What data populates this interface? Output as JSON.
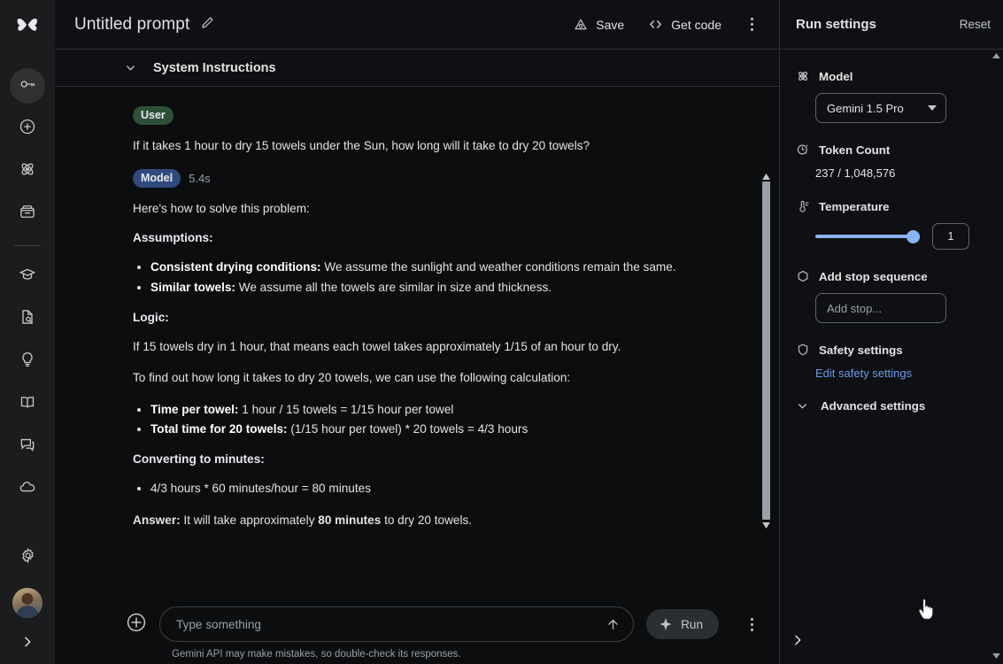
{
  "app": {
    "logo_icon": "butterfly-logo-icon"
  },
  "sidebar": {
    "items": [
      {
        "icon": "key-icon",
        "name": "api-key",
        "active": true
      },
      {
        "icon": "plus-circle-icon",
        "name": "new-prompt",
        "active": false
      },
      {
        "icon": "atom-icon",
        "name": "tune-model",
        "active": false
      },
      {
        "icon": "archive-icon",
        "name": "library",
        "active": false
      },
      {
        "icon": "graduation-cap-icon",
        "name": "learn",
        "active": false
      },
      {
        "icon": "document-search-icon",
        "name": "documentation",
        "active": false
      },
      {
        "icon": "lightbulb-icon",
        "name": "examples",
        "active": false
      },
      {
        "icon": "book-icon",
        "name": "guide",
        "active": false
      },
      {
        "icon": "chat-icon",
        "name": "feedback",
        "active": false
      },
      {
        "icon": "cloud-icon",
        "name": "cloud-console",
        "active": false
      }
    ],
    "settings_icon": "gear-icon",
    "avatar_name": "user-avatar",
    "expand_icon": "chevron-right-icon"
  },
  "topbar": {
    "title": "Untitled prompt",
    "edit_icon": "pencil-icon",
    "save_label": "Save",
    "save_icon": "save-cloud-icon",
    "get_code_label": "Get code",
    "get_code_icon": "code-brackets-icon",
    "more_icon": "kebab-menu-icon"
  },
  "system_instructions": {
    "label": "System Instructions",
    "chevron_icon": "chevron-down-icon",
    "expanded": false
  },
  "conversation": {
    "turns": [
      {
        "role_badge": "User",
        "role": "user",
        "latency": "",
        "blocks": [
          {
            "type": "p",
            "text": "If it takes 1 hour to dry 15 towels under the Sun, how long will it take to dry 20 towels?"
          }
        ]
      },
      {
        "role_badge": "Model",
        "role": "model",
        "latency": "5.4s",
        "blocks": [
          {
            "type": "p",
            "text": "Here's how to solve this problem:"
          },
          {
            "type": "h",
            "text": "Assumptions:"
          },
          {
            "type": "ul",
            "items": [
              {
                "bold": "Consistent drying conditions:",
                "rest": " We assume the sunlight and weather conditions remain the same."
              },
              {
                "bold": "Similar towels:",
                "rest": " We assume all the towels are similar in size and thickness."
              }
            ]
          },
          {
            "type": "h",
            "text": "Logic:"
          },
          {
            "type": "p",
            "text": "If 15 towels dry in 1 hour, that means each towel takes approximately 1/15 of an hour to dry."
          },
          {
            "type": "p",
            "text": "To find out how long it takes to dry 20 towels, we can use the following calculation:"
          },
          {
            "type": "ul",
            "items": [
              {
                "bold": "Time per towel:",
                "rest": " 1 hour / 15 towels = 1/15 hour per towel"
              },
              {
                "bold": "Total time for 20 towels:",
                "rest": " (1/15 hour per towel) * 20 towels = 4/3 hours"
              }
            ]
          },
          {
            "type": "h",
            "text": "Converting to minutes:"
          },
          {
            "type": "ul",
            "items": [
              {
                "bold": "",
                "rest": "4/3 hours * 60 minutes/hour = 80 minutes"
              }
            ]
          },
          {
            "type": "answer",
            "label": "Answer:",
            "mid": " It will take approximately ",
            "bold": "80 minutes",
            "tail": " to dry 20 towels."
          }
        ]
      }
    ]
  },
  "composer": {
    "add_icon": "plus-circle-icon",
    "placeholder": "Type something",
    "value": "",
    "submit_icon": "arrow-up-icon",
    "run_label": "Run",
    "run_icon": "sparkle-icon",
    "more_icon": "kebab-menu-icon",
    "disclaimer": "Gemini API may make mistakes, so double-check its responses."
  },
  "run_settings": {
    "title": "Run settings",
    "reset_label": "Reset",
    "model": {
      "label": "Model",
      "icon": "atom-icon",
      "selected": "Gemini 1.5 Pro",
      "caret_icon": "caret-down-icon"
    },
    "token_count": {
      "label": "Token Count",
      "icon": "token-icon",
      "value": "237 / 1,048,576"
    },
    "temperature": {
      "label": "Temperature",
      "icon": "thermometer-icon",
      "value": "1",
      "slider_percent": 100
    },
    "stop_sequence": {
      "label": "Add stop sequence",
      "icon": "hexagon-icon",
      "placeholder": "Add stop...",
      "value": ""
    },
    "safety": {
      "label": "Safety settings",
      "icon": "shield-icon",
      "link_label": "Edit safety settings"
    },
    "advanced": {
      "label": "Advanced settings",
      "icon": "chevron-down-icon"
    },
    "collapse_icon": "chevron-right-icon"
  },
  "colors": {
    "bg": "#0b0d0f",
    "panel_bg": "#0e1013",
    "rail_bg": "#1b1c1e",
    "border": "#2c2e31",
    "accent_blue": "#8ab4f8",
    "link_blue": "#6f9aeb",
    "user_badge": "#2d5138",
    "model_badge": "#2f4a7d",
    "text": "#e3e3e3",
    "muted": "#9aa0a6"
  }
}
